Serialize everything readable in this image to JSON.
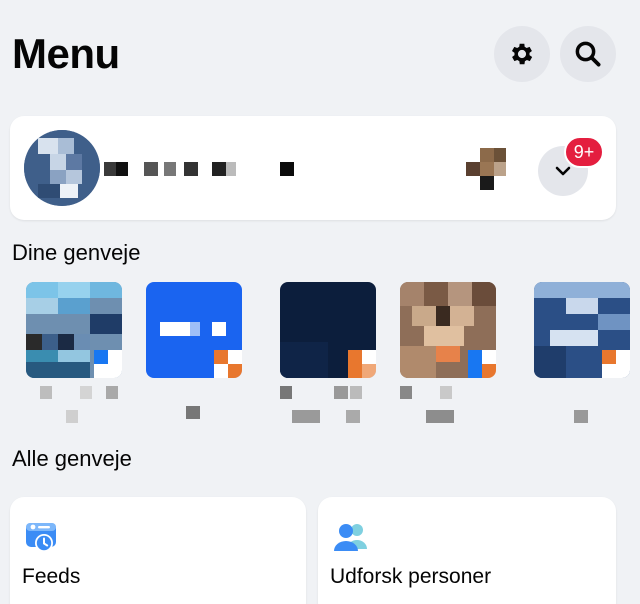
{
  "header": {
    "title": "Menu",
    "settings_icon": "gear-icon",
    "search_icon": "search-icon"
  },
  "profile": {
    "avatar": "avatar-pixelated",
    "name": "",
    "notification_badge": "9+",
    "expand_icon": "chevron-down-icon",
    "badge_color": "#e41e3f"
  },
  "sections": {
    "your_shortcuts": "Dine genveje",
    "all_shortcuts": "Alle genveje"
  },
  "shortcuts": [
    {
      "name": "shortcut-1",
      "label": ""
    },
    {
      "name": "shortcut-2",
      "label": ""
    },
    {
      "name": "shortcut-3",
      "label": ""
    },
    {
      "name": "shortcut-4",
      "label": ""
    },
    {
      "name": "shortcut-5",
      "label": ""
    }
  ],
  "nav_cards": [
    {
      "label": "Feeds",
      "icon": "feeds-icon"
    },
    {
      "label": "Udforsk personer",
      "icon": "people-icon"
    }
  ],
  "colors": {
    "background": "#f0f2f5",
    "card": "#ffffff",
    "accent_blue": "#1877f2"
  }
}
